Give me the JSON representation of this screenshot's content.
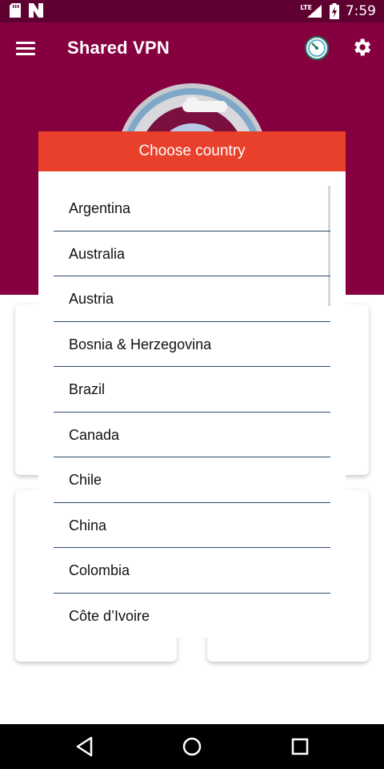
{
  "status_bar": {
    "time": "7:59",
    "network": "LTE"
  },
  "app_bar": {
    "title": "Shared VPN"
  },
  "dialog": {
    "title": "Choose country",
    "countries": [
      "Argentina",
      "Australia",
      "Austria",
      "Bosnia & Herzegovina",
      "Brazil",
      "Canada",
      "Chile",
      "China",
      "Colombia",
      "Côte d’Ivoire"
    ]
  },
  "colors": {
    "status_bar": "#5e0030",
    "app_bar": "#860040",
    "dialog_header": "#e8402a",
    "divider": "#2f4a6a"
  },
  "icons": [
    "menu-icon",
    "speed-test-icon",
    "gear-icon",
    "back-icon",
    "home-icon",
    "recents-icon"
  ]
}
